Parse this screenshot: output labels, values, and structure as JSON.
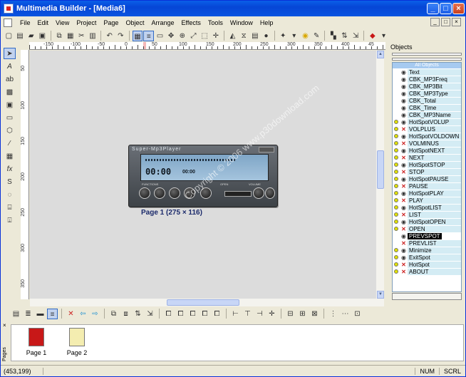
{
  "window": {
    "title": "Multimedia Builder - [Media6]"
  },
  "menus": [
    "File",
    "Edit",
    "View",
    "Project",
    "Page",
    "Object",
    "Arrange",
    "Effects",
    "Tools",
    "Window",
    "Help"
  ],
  "ruler": {
    "h": [
      "-150",
      "-100",
      "-50",
      "0",
      "50",
      "100",
      "150",
      "200",
      "250",
      "300",
      "350",
      "400",
      "45"
    ],
    "v": [
      "50",
      "100",
      "150",
      "200",
      "250",
      "300",
      "350"
    ]
  },
  "player": {
    "title": "Super-Mp3Player",
    "time": "00:00",
    "time_small": "00:00",
    "labels": [
      "FUNCTIONS",
      "OPEN",
      "VOLUME"
    ]
  },
  "page_caption": "Page 1 (275 × 116)",
  "watermark": "Copyright © 2006 www.p30download.com",
  "objects": {
    "header": "Objects",
    "all_label": "All Objects",
    "items": [
      {
        "name": "Text",
        "icon": "eye",
        "dot": false
      },
      {
        "name": "CBK_MP3Freq",
        "icon": "eye",
        "dot": false
      },
      {
        "name": "CBK_MP3Bit",
        "icon": "eye",
        "dot": false
      },
      {
        "name": "CBK_MP3Type",
        "icon": "eye",
        "dot": false
      },
      {
        "name": "CBK_Total",
        "icon": "eye",
        "dot": false
      },
      {
        "name": "CBK_Time",
        "icon": "eye",
        "dot": false
      },
      {
        "name": "CBK_MP3Name",
        "icon": "eye",
        "dot": false
      },
      {
        "name": "HotSpotVOLUP",
        "icon": "eye",
        "dot": true
      },
      {
        "name": "VOLPLUS",
        "icon": "x",
        "dot": true
      },
      {
        "name": "HotSpotVOLDOWN",
        "icon": "eye",
        "dot": true
      },
      {
        "name": "VOLMINUS",
        "icon": "x",
        "dot": true
      },
      {
        "name": "HotSpotNEXT",
        "icon": "eye",
        "dot": true
      },
      {
        "name": "NEXT",
        "icon": "x",
        "dot": true
      },
      {
        "name": "HotSpotSTOP",
        "icon": "eye",
        "dot": true
      },
      {
        "name": "STOP",
        "icon": "x",
        "dot": true
      },
      {
        "name": "HotSpotPAUSE",
        "icon": "eye",
        "dot": true
      },
      {
        "name": "PAUSE",
        "icon": "x",
        "dot": true
      },
      {
        "name": "HotSpotPLAY",
        "icon": "eye",
        "dot": true
      },
      {
        "name": "PLAY",
        "icon": "x",
        "dot": true
      },
      {
        "name": "HotSpotLIST",
        "icon": "eye",
        "dot": true
      },
      {
        "name": "LIST",
        "icon": "x",
        "dot": true
      },
      {
        "name": "HotSpotOPEN",
        "icon": "eye",
        "dot": true
      },
      {
        "name": "OPEN",
        "icon": "x",
        "dot": true
      },
      {
        "name": "PREVSPOT",
        "icon": "eye",
        "dot": false,
        "selected": true
      },
      {
        "name": "PREVLIST",
        "icon": "x",
        "dot": false
      },
      {
        "name": "Minimize",
        "icon": "eye",
        "dot": true
      },
      {
        "name": "ExitSpot",
        "icon": "eye",
        "dot": true
      },
      {
        "name": "HotSpot",
        "icon": "x",
        "dot": true
      },
      {
        "name": "ABOUT",
        "icon": "x",
        "dot": true
      }
    ]
  },
  "pages": {
    "tab_label": "Pages",
    "items": [
      {
        "label": "Page 1",
        "color": "#c81818"
      },
      {
        "label": "Page 2",
        "color": "#f4edb0"
      }
    ]
  },
  "status": {
    "coords": "(453,199)",
    "num": "NUM",
    "scrl": "SCRL"
  }
}
